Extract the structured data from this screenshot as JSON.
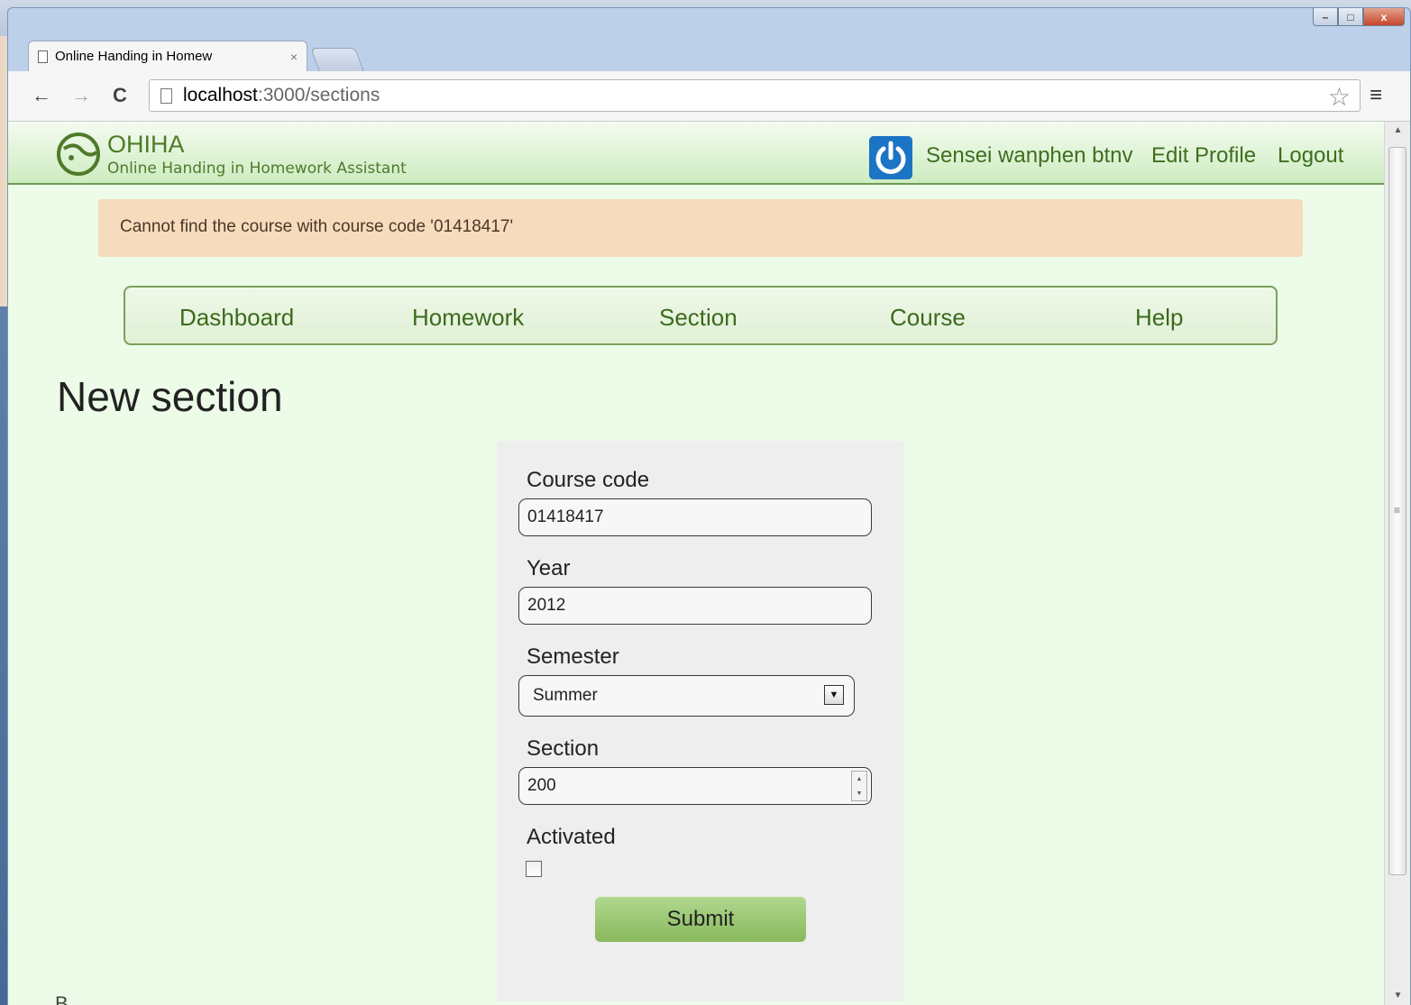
{
  "browser": {
    "tab_title": "Online Handing in Homew",
    "tab_close": "×",
    "url_host": "localhost",
    "url_path": ":3000/sections",
    "window_controls": {
      "minimize": "–",
      "maximize": "□",
      "close": "x"
    }
  },
  "site": {
    "logo_title": "OHIHA",
    "logo_subtitle": "Online Handing in Homework Assistant",
    "user_name": "Sensei wanphen btnv",
    "edit_profile": "Edit Profile",
    "logout": "Logout"
  },
  "flash": {
    "message": "Cannot find the course with course code '01418417'"
  },
  "nav": {
    "items": [
      {
        "label": "Dashboard"
      },
      {
        "label": "Homework"
      },
      {
        "label": "Section"
      },
      {
        "label": "Course"
      },
      {
        "label": "Help"
      }
    ]
  },
  "page": {
    "title": "New section"
  },
  "form": {
    "course_code_label": "Course code",
    "course_code_value": "01418417",
    "year_label": "Year",
    "year_value": "2012",
    "semester_label": "Semester",
    "semester_value": "Summer",
    "section_label": "Section",
    "section_value": "200",
    "activated_label": "Activated",
    "activated_checked": false,
    "submit_label": "Submit"
  },
  "footer": {
    "partial_text": "B..."
  },
  "colors": {
    "page_background": "#ecfce8",
    "accent_green": "#3d6a1d",
    "flash_background": "#f7dbbd",
    "submit_background": "#9cc975",
    "power_icon_blue": "#1c74c4"
  }
}
